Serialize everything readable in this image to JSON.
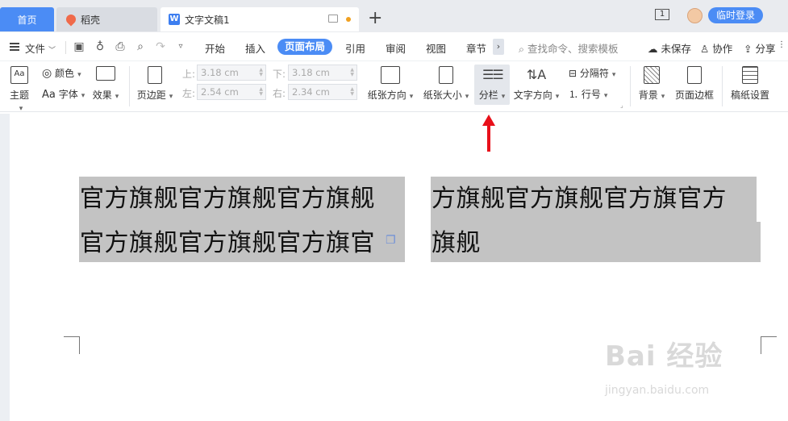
{
  "tabs": {
    "home": "首页",
    "daoke": "稻壳",
    "doc": "文字文稿1",
    "add": "+"
  },
  "window": {
    "num": "1",
    "login": "临时登录"
  },
  "menu": {
    "file": "文件",
    "tabs": [
      "开始",
      "插入",
      "页面布局",
      "引用",
      "审阅",
      "视图",
      "章节"
    ],
    "active": "页面布局",
    "search": "查找命令、搜索模板",
    "unsaved": "未保存",
    "collab": "协作",
    "share": "分享"
  },
  "ribbon": {
    "theme": "主题",
    "color": "颜色",
    "font": "字体",
    "effect": "效果",
    "margin": "页边距",
    "top_label": "上:",
    "top_value": "3.18 cm",
    "bottom_label": "下:",
    "bottom_value": "3.18 cm",
    "left_label": "左:",
    "left_value": "2.54 cm",
    "right_label": "右:",
    "right_value": "2.34 cm",
    "orientation": "纸张方向",
    "size": "纸张大小",
    "columns": "分栏",
    "text_direction": "文字方向",
    "break": "分隔符",
    "line_number": "行号",
    "background": "背景",
    "page_border": "页面边框",
    "paper_settings": "稿纸设置"
  },
  "document": {
    "col1_line1": "官方旗舰官方旗舰官方旗舰",
    "col1_line2": "官方旗舰官方旗舰官方旗官",
    "col2_line1": "方旗舰官方旗舰官方旗官方",
    "col2_line2": "旗舰"
  },
  "watermark": {
    "main": "Bai 经验",
    "sub": "jingyan.baidu.com"
  },
  "colors": {
    "accent": "#4b8cf5",
    "selection": "#c3c3c3",
    "arrow": "#e8101a"
  }
}
